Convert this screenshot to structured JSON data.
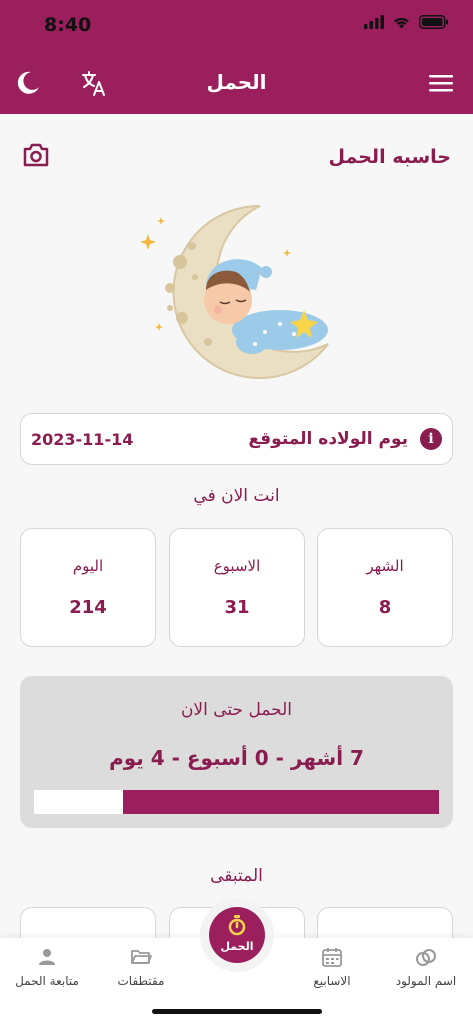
{
  "status_bar": {
    "time": "8:40"
  },
  "app_bar": {
    "title": "الحمل"
  },
  "page": {
    "section_title": "حاسبه الحمل"
  },
  "due_date": {
    "label": "يوم الولاده المتوقع",
    "value": "2023-11-14"
  },
  "now": {
    "title": "انت الان في",
    "stats": [
      {
        "label": "الشهر",
        "value": "8"
      },
      {
        "label": "الاسبوع",
        "value": "31"
      },
      {
        "label": "اليوم",
        "value": "214"
      }
    ]
  },
  "progress": {
    "title": "الحمل حتى الان",
    "value_text": "7 أشهر - 0 أسبوع - 4 يوم",
    "fraction": 0.78
  },
  "remaining": {
    "title": "المتبقى"
  },
  "bottom_nav": {
    "items": [
      {
        "label": "اسم المولود",
        "icon": "rings-icon"
      },
      {
        "label": "الاسابيع",
        "icon": "calendar-icon"
      },
      {
        "label": "مقتطفات",
        "icon": "folder-icon"
      },
      {
        "label": "متابعة الحمل",
        "icon": "person-icon"
      }
    ],
    "center_label": "الحمل"
  },
  "colors": {
    "primary": "#9b1f5c",
    "text_accent": "#8a1d50",
    "background": "#f7f7f7"
  }
}
